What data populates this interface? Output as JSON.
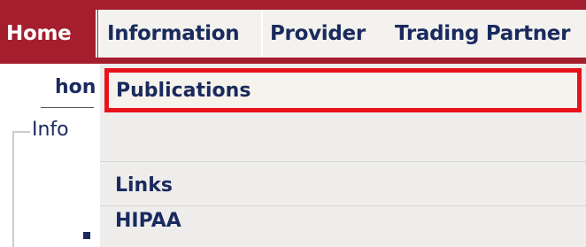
{
  "nav": {
    "items": [
      {
        "label": "Home"
      },
      {
        "label": "Information"
      },
      {
        "label": "Provider"
      },
      {
        "label": "Trading Partner"
      }
    ]
  },
  "breadcrumb": {
    "text": "hon"
  },
  "panel": {
    "legend": "Info"
  },
  "dropdown": {
    "items": [
      {
        "label": "Publications"
      },
      {
        "label": "Links"
      },
      {
        "label": "HIPAA"
      }
    ]
  },
  "colors": {
    "brand": "#a51e2d",
    "nav_bg": "#f3f2ee",
    "text": "#1a2a5e",
    "highlight_border": "#e8131a",
    "dropdown_bg": "#eeedec"
  }
}
